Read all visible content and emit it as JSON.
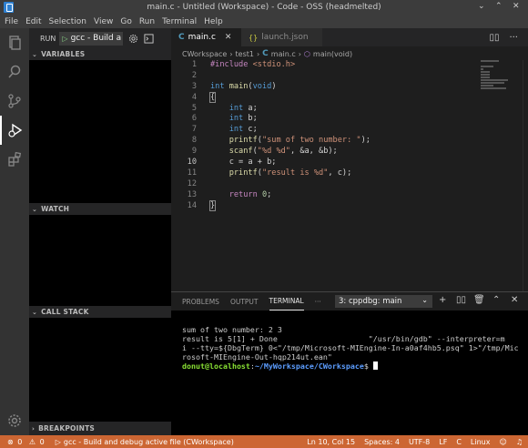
{
  "window": {
    "title": "main.c - Untitled (Workspace) - Code - OSS (headmelted)"
  },
  "menu": [
    "File",
    "Edit",
    "Selection",
    "View",
    "Go",
    "Run",
    "Terminal",
    "Help"
  ],
  "run_panel": {
    "run_label": "RUN",
    "config": "gcc - Build a",
    "sections": {
      "variables": "VARIABLES",
      "watch": "WATCH",
      "call_stack": "CALL STACK",
      "breakpoints": "BREAKPOINTS"
    }
  },
  "tabs": [
    {
      "label": "main.c",
      "active": true
    },
    {
      "label": "launch.json",
      "active": false
    }
  ],
  "breadcrumbs": [
    "CWorkspace",
    "test1",
    "main.c",
    "main(void)"
  ],
  "code": {
    "line_numbers": [
      "1",
      "2",
      "3",
      "4",
      "5",
      "6",
      "7",
      "8",
      "9",
      "10",
      "11",
      "12",
      "13",
      "14"
    ],
    "current_line": "10"
  },
  "panel": {
    "tabs": [
      "PROBLEMS",
      "OUTPUT",
      "TERMINAL"
    ],
    "active_tab": "TERMINAL",
    "more": "···",
    "terminal_select": "3: cppdbg: main",
    "terminal": {
      "line1": "sum of two number: 2 3",
      "line2": "result is 5[1] + Done                    \"/usr/bin/gdb\" --interpreter=m",
      "line3": "i --tty=${DbgTerm} 0<\"/tmp/Microsoft-MIEngine-In-a0af4hb5.psq\" 1>\"/tmp/Mic",
      "line4": "rosoft-MIEngine-Out-hqp214ut.ean\"",
      "prompt_user": "donut@localhost",
      "prompt_sep": ":",
      "prompt_path": "~/MyWorkspace/CWorkspace",
      "prompt_end": "$ "
    }
  },
  "statusbar": {
    "errors": "0",
    "warnings": "0",
    "debug": "gcc - Build and debug active file (CWorkspace)",
    "position": "Ln 10, Col 15",
    "spaces": "Spaces: 4",
    "encoding": "UTF-8",
    "eol": "LF",
    "language": "C",
    "os": "Linux"
  },
  "colors": {
    "statusbar": "#cc6633",
    "activity_bar": "#333333",
    "sidebar": "#252526",
    "editor": "#1e1e1e"
  }
}
